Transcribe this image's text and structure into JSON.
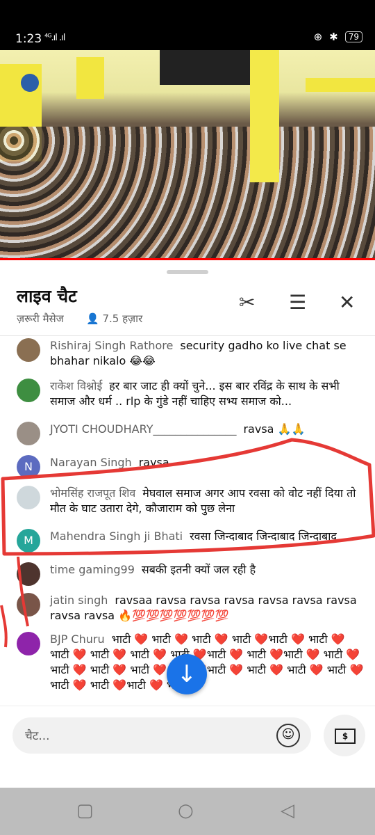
{
  "status_bar": {
    "time": "1:23",
    "signal": "⁴ᴳ.ıl .ıl",
    "battery": "79"
  },
  "chat": {
    "title": "लाइव चैट",
    "filter": "ज़रूरी मैसेज",
    "viewers": "7.5 हज़ार"
  },
  "messages": [
    {
      "author": "Rishiraj Singh Rathore",
      "text": "security gadho ko live chat se bhahar nikalo 😂😂",
      "avatar_color": "#8a6f52"
    },
    {
      "author": "राकेश विश्नोई",
      "text": "हर बार जाट ही क्यों चुने... इस बार रविंद्र के साथ के सभी समाज और धर्म .. rlp के गुंडे नहीं चाहिए सभ्य समाज को...",
      "avatar_color": "#3e8e41"
    },
    {
      "author": "JYOTI CHOUDHARY_______________",
      "text": "ravsa 🙏🙏",
      "avatar_color": "#9a8f86"
    },
    {
      "author": "Narayan Singh",
      "text": "ravsa",
      "avatar_color": "#5c6bc0",
      "avatar_letter": "N"
    },
    {
      "author": "भोमसिंह राजपूत शिव",
      "text": "मेघवाल समाज अगर आप रवसा को वोट नहीं दिया तो मौत के घाट उतारा देगे, कौजाराम को पुछ लेना",
      "avatar_color": "#cfd8dc"
    },
    {
      "author": "Mahendra Singh ji Bhati",
      "text": "रवसा जिन्दाबाद जिन्दाबाद जिन्दाबाद",
      "avatar_color": "#26a69a",
      "avatar_letter": "M"
    },
    {
      "author": "time gaming99",
      "text": "सबकी इतनी क्यों जल रही है",
      "avatar_color": "#4e342e"
    },
    {
      "author": "jatin singh",
      "text": "ravsaa ravsa ravsa ravsa ravsa ravsa ravsa ravsa ravsa 🔥💯💯💯💯💯💯💯",
      "avatar_color": "#795548"
    },
    {
      "author": "BJP Churu",
      "text": "भाटी ❤️ भाटी ❤️ भाटी ❤️ भाटी ❤️भाटी ❤️ भाटी ❤️भाटी ❤️ भाटी ❤️ भाटी ❤️ भाटी ❤️भाटी ❤️ भाटी ❤️भाटी ❤️ भाटी ❤️ भाटी ❤️ भाटी ❤️ भाटी ❤️ भाटी ❤️भाटी ❤️ भाटी ❤️ भाटी ❤️ भाटी ❤️भाटी ❤️ भाटी ❤️भाटी ❤️ भाटी ❤️",
      "avatar_color": "#8e24aa"
    }
  ],
  "input": {
    "placeholder": "चैट..."
  },
  "icons": {
    "clip": "scissors-icon",
    "settings": "sliders-icon",
    "close": "close-icon",
    "scroll": "arrow-down-icon"
  },
  "colors": {
    "accent": "#1a73e8",
    "annotation": "#e53935"
  }
}
